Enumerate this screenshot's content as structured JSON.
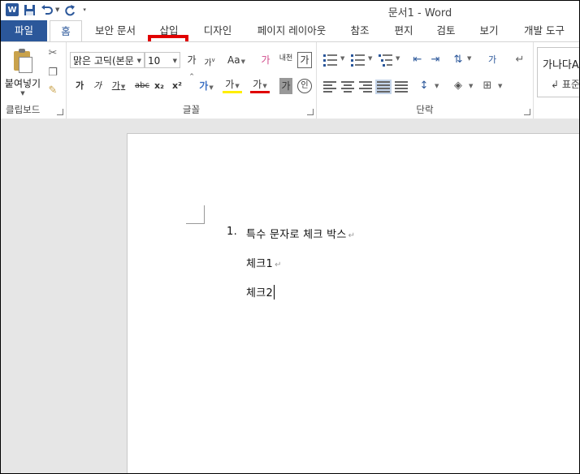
{
  "app": {
    "logo_letter": "W",
    "title": "문서1 - Word"
  },
  "quick_access": {
    "save_icon": "save-icon",
    "undo_icon": "undo-icon",
    "redo_icon": "redo-icon",
    "customize_icon": "customize-icon"
  },
  "tabs": {
    "file": "파일",
    "home": "홈",
    "security": "보안 문서",
    "insert": "삽입",
    "design": "디자인",
    "layout": "페이지 레이아웃",
    "references": "참조",
    "mailings": "편지",
    "review": "검토",
    "view": "보기",
    "developer": "개발 도구"
  },
  "ribbon": {
    "clipboard": {
      "paste_label": "붙여넣기",
      "group_label": "클립보드"
    },
    "font": {
      "font_name": "맑은 고딕(본문",
      "font_size": "10",
      "grow": "가",
      "shrink": "가",
      "change_case": "Aa",
      "clear_format": "가",
      "phonetic": "내천",
      "char_border": "가",
      "bold": "가",
      "italic": "가",
      "underline": "가",
      "strike": "abc",
      "subscript": "x₂",
      "superscript": "x²",
      "text_effect": "가",
      "highlight": "가",
      "font_color": "가",
      "char_shading": "가",
      "enclose": "인",
      "group_label": "글꼴"
    },
    "paragraph": {
      "group_label": "단락"
    },
    "styles": {
      "sample": "가나다A",
      "name": "↲ 표준"
    }
  },
  "document": {
    "list_number": "1.",
    "line1": "특수 문자로 체크 박스",
    "line2": "체크1",
    "line3": "체크2",
    "para_mark": "↵"
  }
}
